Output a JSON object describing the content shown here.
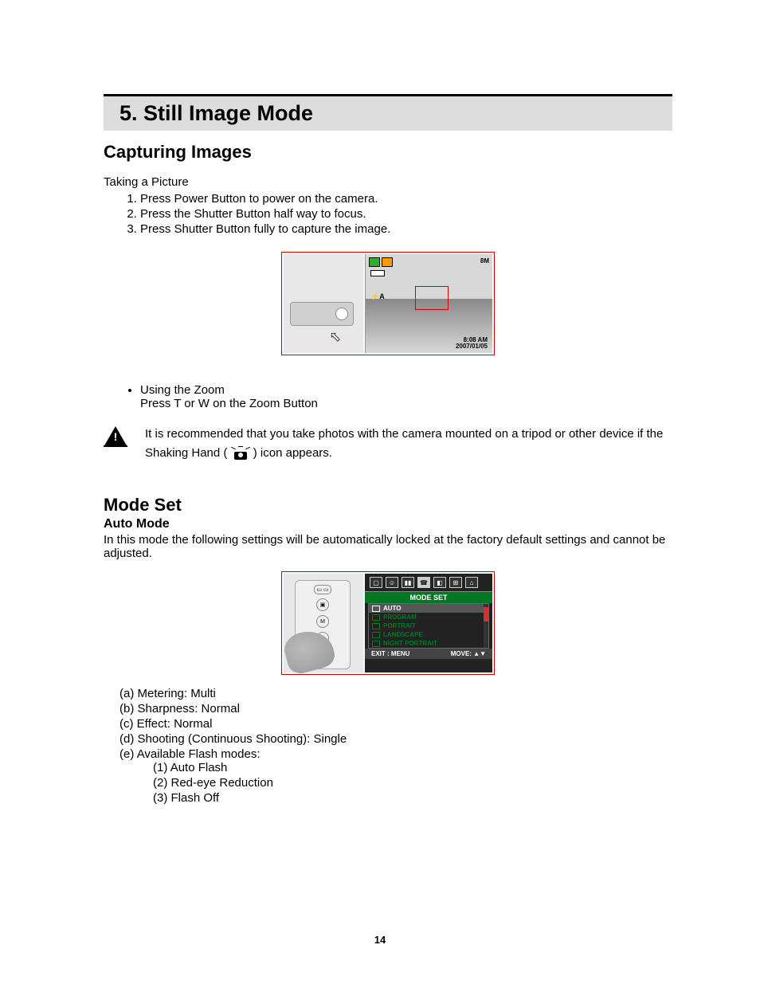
{
  "page_number": "14",
  "title": "5. Still Image Mode",
  "sections": {
    "capturing": {
      "heading": "Capturing Images",
      "intro": "Taking a Picture",
      "steps": [
        "Press Power Button to power on the camera.",
        "Press the Shutter Button half way to focus.",
        "Press Shutter Button fully to capture the image."
      ],
      "zoom": {
        "heading": "Using the Zoom",
        "line": "Press T or W on the Zoom Button"
      },
      "note_before": "It is recommended that you take photos with the camera mounted on a tripod or other device if the Shaking Hand (",
      "note_after": ") icon appears."
    },
    "modeset": {
      "heading": "Mode Set",
      "sub": "Auto Mode",
      "desc": "In this mode the following settings will be automatically locked at the factory default settings and cannot be adjusted.",
      "letters": [
        "Metering: Multi",
        "Sharpness: Normal",
        "Effect: Normal",
        "Shooting (Continuous Shooting): Single",
        "Available Flash modes:"
      ],
      "flash_modes": [
        "Auto Flash",
        "Red-eye Reduction",
        "Flash Off"
      ]
    }
  },
  "fig1_osd": {
    "top_right": "8M",
    "flash": "⚡A",
    "time": "8:08 AM",
    "date": "2007/01/05"
  },
  "fig2_menu": {
    "header": "MODE SET",
    "items": [
      "AUTO",
      "PROGRAM",
      "PORTRAIT",
      "LANDSCAPE",
      "NIGHT PORTRAIT"
    ],
    "footer_left": "EXIT : MENU",
    "footer_right": "MOVE: ▲▼"
  }
}
